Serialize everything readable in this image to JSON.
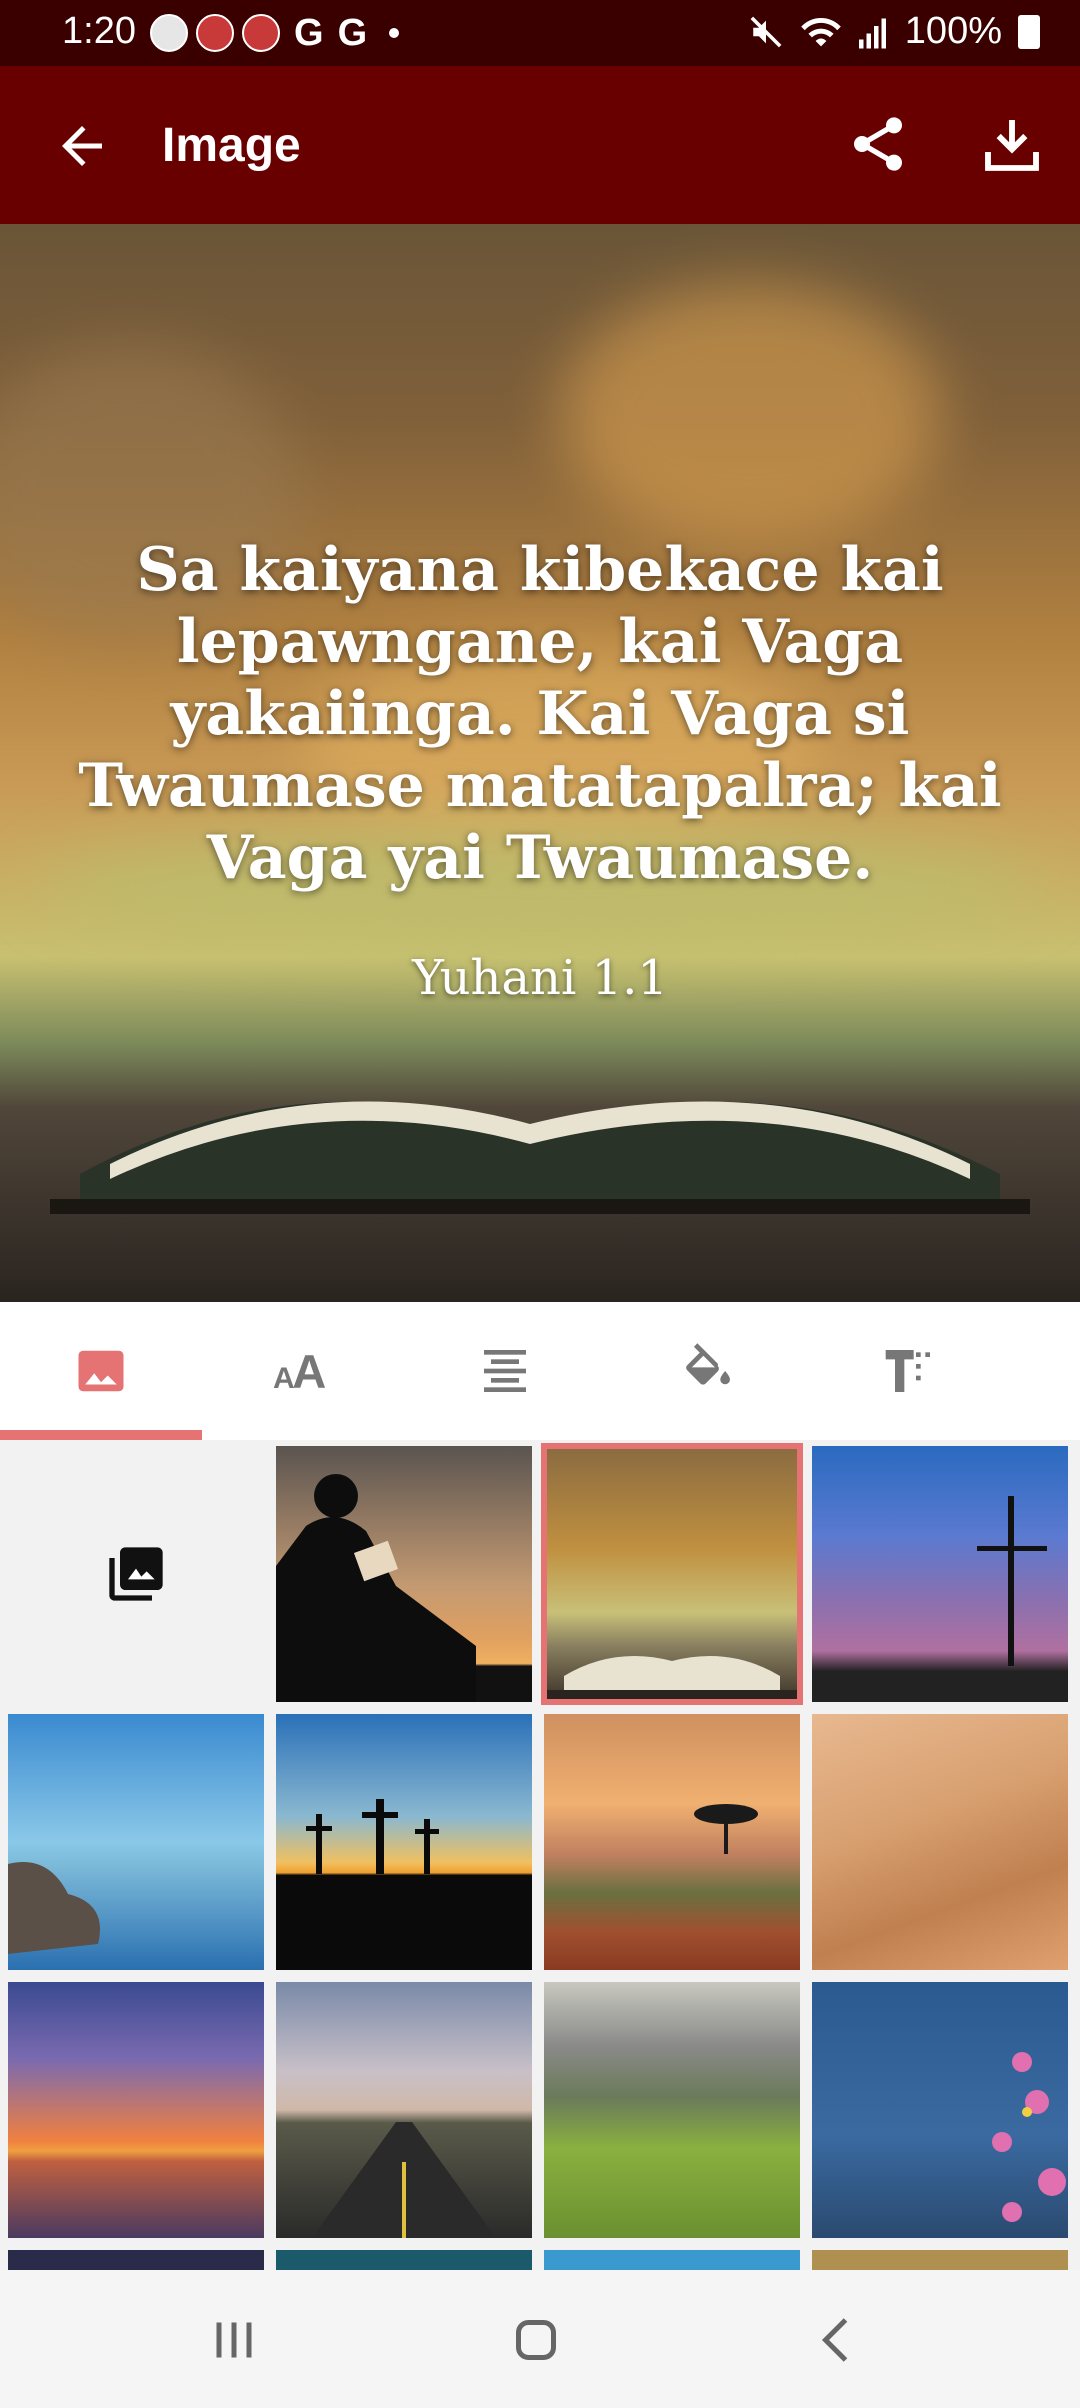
{
  "status_bar": {
    "time": "1:20",
    "notifications": [
      "bible-app-icon",
      "video-app-icon",
      "video-app-icon",
      "google-icon",
      "google-icon",
      "dot-icon"
    ],
    "google_letters": [
      "G",
      "G"
    ],
    "battery": "100%",
    "icons": [
      "mute-icon",
      "wifi-icon",
      "signal-icon",
      "battery-icon"
    ]
  },
  "appbar": {
    "title": "Image",
    "back_icon": "arrow-back-icon",
    "share_icon": "share-icon",
    "download_icon": "download-icon",
    "bg_color": "#690000"
  },
  "preview": {
    "verse_text": "Sa kaiyana kibekace kai lepawngane, kai Vaga yakaiinga. Kai Vaga si Twaumase matatapalra; kai Vaga yai Twaumase.",
    "reference": "Yuhani 1.1"
  },
  "editor_tabs": [
    {
      "name": "background-image",
      "icon": "image-icon",
      "selected": true
    },
    {
      "name": "font",
      "icon": "font-size-icon",
      "selected": false
    },
    {
      "name": "alignment",
      "icon": "align-center-icon",
      "selected": false
    },
    {
      "name": "color",
      "icon": "paint-bucket-icon",
      "selected": false
    },
    {
      "name": "text-style",
      "icon": "text-format-icon",
      "selected": false
    }
  ],
  "accent_color": "#e57373",
  "backgrounds": [
    {
      "name": "gallery-picker",
      "icon": "photo-library-icon"
    },
    {
      "name": "silhouette-reading"
    },
    {
      "name": "open-bible",
      "selected": true
    },
    {
      "name": "cross-sunset"
    },
    {
      "name": "lake-rocks"
    },
    {
      "name": "three-crosses"
    },
    {
      "name": "savanna-sunset"
    },
    {
      "name": "desert-dunes"
    },
    {
      "name": "ocean-sunset"
    },
    {
      "name": "road"
    },
    {
      "name": "green-hills"
    },
    {
      "name": "pink-flowers"
    }
  ],
  "nav": [
    "recents-icon",
    "home-icon",
    "back-icon"
  ]
}
